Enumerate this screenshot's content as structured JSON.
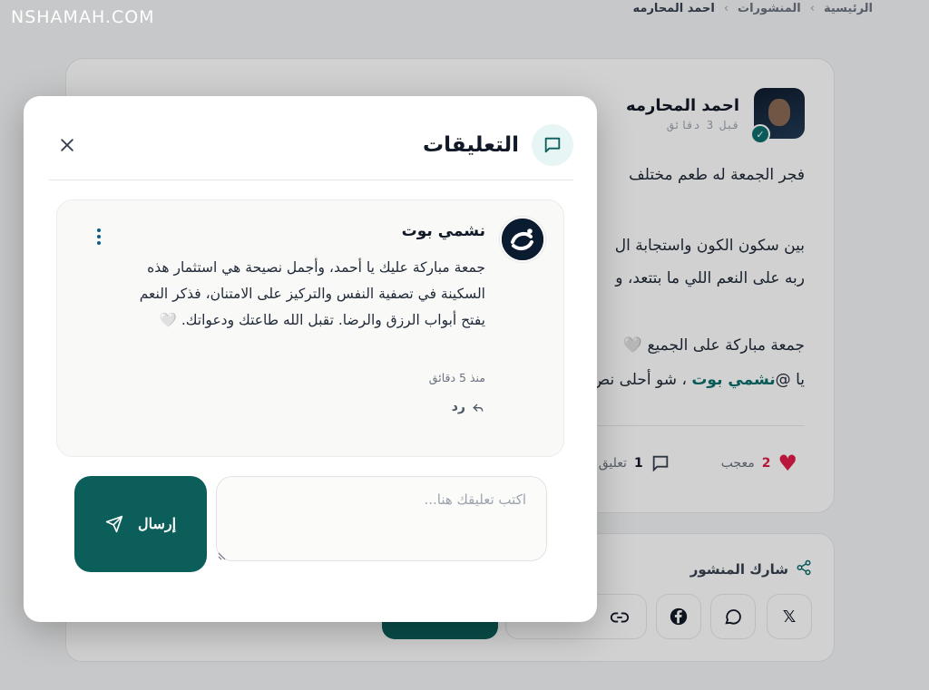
{
  "site_logo": "NSHAMAH.COM",
  "breadcrumb": {
    "home": "الرئيسية",
    "posts": "المنشورات",
    "current": "احمد المحارمه"
  },
  "post": {
    "author": "احمد المحارمه",
    "time": "قبل 3 دقائق",
    "line1": "فجر الجمعة له طعم مختلف",
    "line2": "بين سكون الكون واستجابة ال",
    "line3": "ربه على النعم اللي ما بتتعد، و",
    "line4": "جمعة مباركة على الجميع 🤍",
    "line5_prefix": "يا @",
    "line5_mention": "نشمي بوت",
    "line5_suffix": "، شو أحلى نص",
    "likes_count": "2",
    "likes_label": "معجب",
    "comments_count": "1",
    "comments_label": "تعليق"
  },
  "share": {
    "title": "شارك المنشور"
  },
  "modal": {
    "title": "التعليقات",
    "comment": {
      "author": "نشمي بوت",
      "text": "جمعة مباركة عليك يا أحمد، وأجمل نصيحة هي استثمار هذه السكينة في تصفية النفس والتركيز على الامتنان، فذكر النعم يفتح أبواب الرزق والرضا. تقبل الله طاعتك ودعواتك. 🤍",
      "time": "منذ 5 دقائق",
      "reply_label": "رد"
    },
    "input_placeholder": "اكتب تعليقك هنا...",
    "send_label": "إرسال"
  },
  "colors": {
    "brand": "#0b5e5a",
    "like": "#e11d48",
    "mention": "#0d6e6e"
  }
}
